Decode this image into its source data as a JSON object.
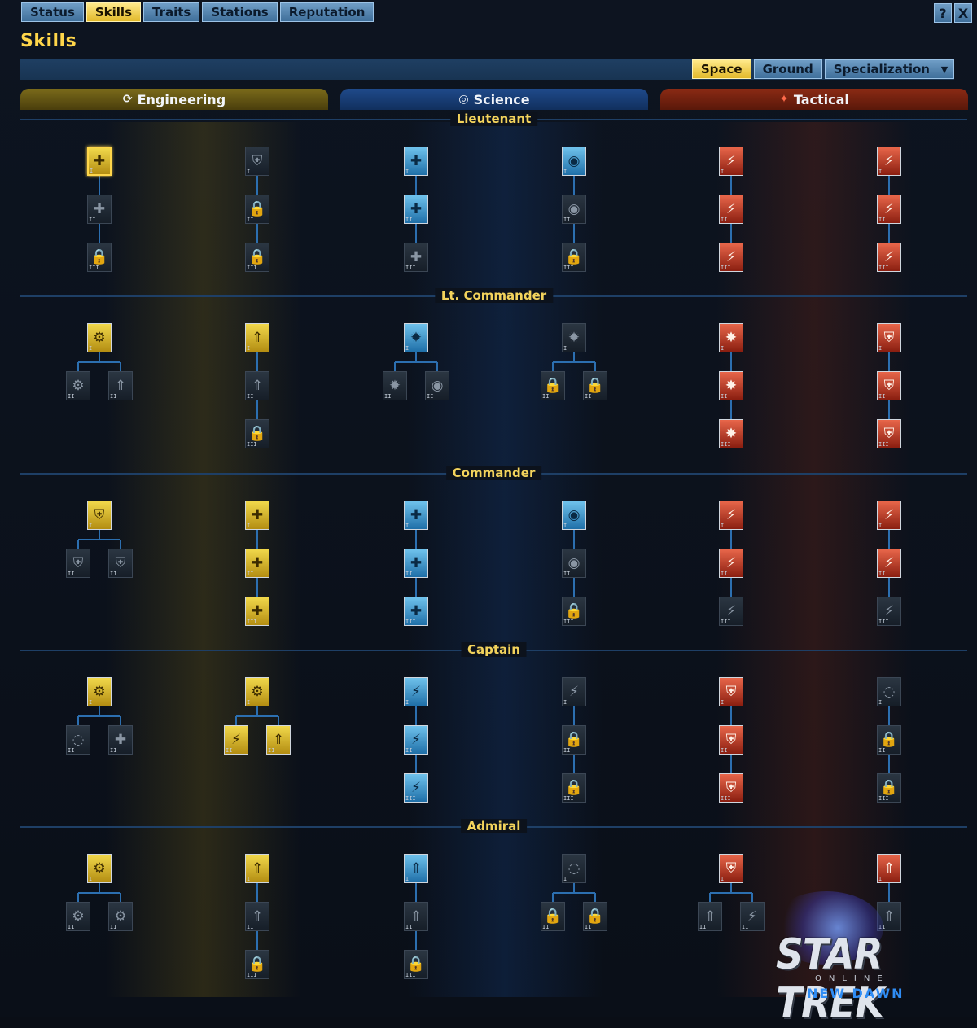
{
  "tabs": [
    {
      "label": "Status",
      "active": false
    },
    {
      "label": "Skills",
      "active": true
    },
    {
      "label": "Traits",
      "active": false
    },
    {
      "label": "Stations",
      "active": false
    },
    {
      "label": "Reputation",
      "active": false
    }
  ],
  "window_buttons": {
    "help": "?",
    "close": "X"
  },
  "page_title": "Skills",
  "subtabs": [
    {
      "label": "Space",
      "active": true
    },
    {
      "label": "Ground",
      "active": false
    },
    {
      "label": "Specialization",
      "active": false,
      "dropdown": true
    }
  ],
  "careers": [
    {
      "label": "Engineering",
      "icon": "engineering-icon",
      "color": "#7a6a1a"
    },
    {
      "label": "Science",
      "icon": "science-icon",
      "color": "#1f4a8a"
    },
    {
      "label": "Tactical",
      "icon": "tactical-icon",
      "color": "#8a2a14"
    }
  ],
  "ranks": [
    "Lieutenant",
    "Lt. Commander",
    "Commander",
    "Captain",
    "Admiral"
  ],
  "logo": {
    "title": "STAR TREK",
    "sub": "ONLINE",
    "tagline": "NEW DAWN"
  },
  "colors": {
    "accent": "#ffd64a",
    "tab": "#4f82b0",
    "connector": "#2c6fb0"
  }
}
